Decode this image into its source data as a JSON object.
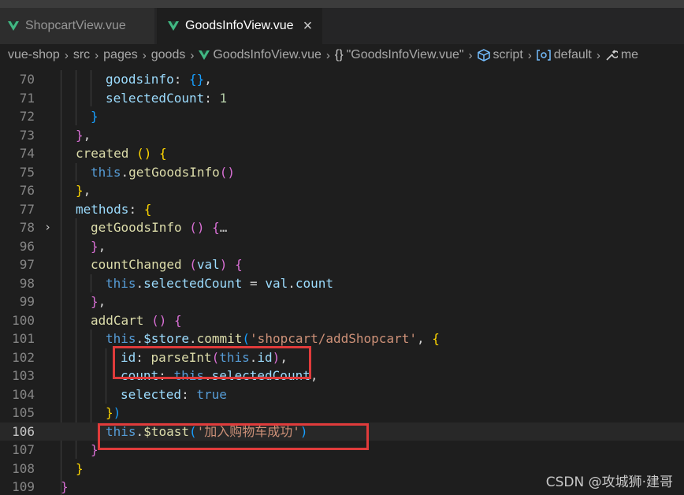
{
  "tabs": [
    {
      "label": "ShopcartView.vue",
      "active": false
    },
    {
      "label": "GoodsInfoView.vue",
      "active": true,
      "close": "×"
    }
  ],
  "breadcrumb": {
    "items": [
      "vue-shop",
      "src",
      "pages",
      "goods",
      "GoodsInfoView.vue",
      "\"GoodsInfoView.vue\"",
      "script",
      "default",
      "me"
    ],
    "icons": [
      "vue-icon",
      "braces-icon",
      "cube-icon",
      "symbol-icon",
      "wrench-icon"
    ]
  },
  "editor": {
    "lines": [
      {
        "n": "70",
        "text": "goodsinfo: {},"
      },
      {
        "n": "71",
        "text": "selectedCount: 1"
      },
      {
        "n": "72",
        "text": "}"
      },
      {
        "n": "73",
        "text": "},"
      },
      {
        "n": "74",
        "text": "created () {"
      },
      {
        "n": "75",
        "text": "this.getGoodsInfo()"
      },
      {
        "n": "76",
        "text": "},"
      },
      {
        "n": "77",
        "text": "methods: {"
      },
      {
        "n": "78",
        "text": "getGoodsInfo () {…"
      },
      {
        "n": "96",
        "text": "},"
      },
      {
        "n": "97",
        "text": "countChanged (val) {"
      },
      {
        "n": "98",
        "text": "this.selectedCount = val.count"
      },
      {
        "n": "99",
        "text": "},"
      },
      {
        "n": "100",
        "text": "addCart () {"
      },
      {
        "n": "101",
        "text": "this.$store.commit('shopcart/addShopcart', {"
      },
      {
        "n": "102",
        "text": "id: parseInt(this.id),"
      },
      {
        "n": "103",
        "text": "count: this.selectedCount,"
      },
      {
        "n": "104",
        "text": "selected: true"
      },
      {
        "n": "105",
        "text": "})"
      },
      {
        "n": "106",
        "text": "this.$toast('加入购物车成功')"
      },
      {
        "n": "107",
        "text": "}"
      },
      {
        "n": "108",
        "text": "}"
      },
      {
        "n": "109",
        "text": "}"
      }
    ]
  },
  "watermark": "CSDN @攻城狮·建哥",
  "colors": {
    "vue_green": "#41b883",
    "highlight_box": "#e03b3b",
    "keyword": "#569cd6",
    "property": "#9cdcfe",
    "function": "#dcdcaa",
    "string": "#ce9178"
  }
}
